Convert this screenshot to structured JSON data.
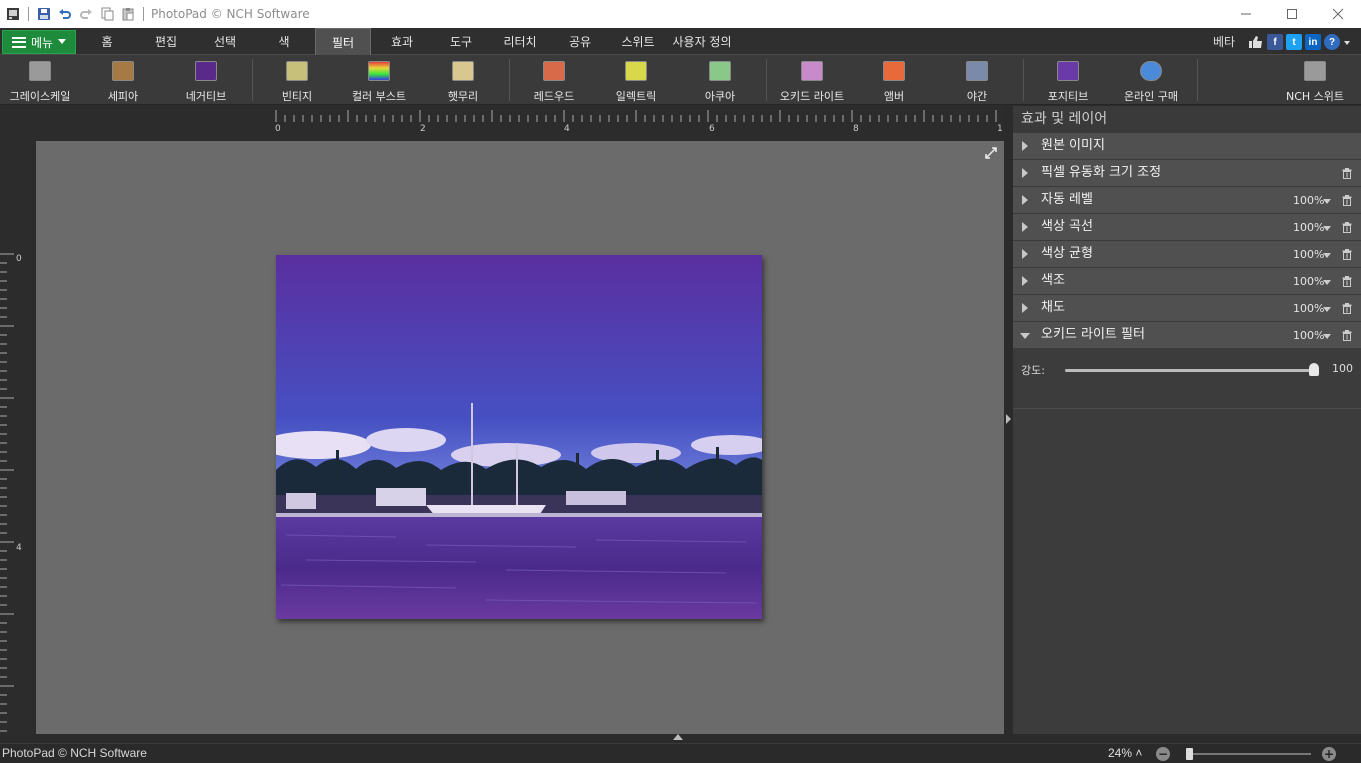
{
  "window": {
    "title": "PhotoPad © NCH Software",
    "controls": [
      "minimize",
      "maximize",
      "close"
    ]
  },
  "quick_access_icons": [
    "app-icon",
    "save-icon",
    "undo-icon",
    "redo-icon",
    "copy-icon",
    "paste-icon"
  ],
  "menu_button": {
    "label": "메뉴"
  },
  "tabs": [
    {
      "label": "홈"
    },
    {
      "label": "편집"
    },
    {
      "label": "선택"
    },
    {
      "label": "색"
    },
    {
      "label": "필터",
      "active": true
    },
    {
      "label": "효과"
    },
    {
      "label": "도구"
    },
    {
      "label": "리터치"
    },
    {
      "label": "공유"
    },
    {
      "label": "스위트"
    },
    {
      "label": "사용자 정의"
    }
  ],
  "beta_label": "베타",
  "social_icons": [
    "like-icon",
    "facebook-icon",
    "twitter-icon",
    "linkedin-icon",
    "help-icon"
  ],
  "ribbon": {
    "buttons": [
      {
        "label": "그레이스케일",
        "icon": "grayscale-icon",
        "color": "#9a9a9a"
      },
      {
        "label": "세피아",
        "icon": "sepia-icon",
        "color": "#a57a45"
      },
      {
        "label": "네거티브",
        "icon": "negative-icon",
        "color": "#5a2a8a"
      },
      {
        "label": "빈티지",
        "icon": "vintage-icon",
        "color": "#c7c07a"
      },
      {
        "label": "컬러 부스트",
        "icon": "color-boost-icon",
        "color": "#d83ad8"
      },
      {
        "label": "햇무리",
        "icon": "halo-icon",
        "color": "#d8c890"
      },
      {
        "label": "레드우드",
        "icon": "redwood-icon",
        "color": "#d86a4a"
      },
      {
        "label": "일렉트릭",
        "icon": "electric-icon",
        "color": "#d8d84a"
      },
      {
        "label": "아쿠아",
        "icon": "aqua-icon",
        "color": "#8ac88a"
      },
      {
        "label": "오키드 라이트",
        "icon": "orchid-light-icon",
        "color": "#c88ac8"
      },
      {
        "label": "앰버",
        "icon": "amber-icon",
        "color": "#e86a3a"
      },
      {
        "label": "야간",
        "icon": "night-icon",
        "color": "#7a8aa8"
      },
      {
        "label": "포지티브",
        "icon": "positive-icon",
        "color": "#6a3aa8"
      },
      {
        "label": "온라인 구매",
        "icon": "buy-online-icon",
        "color": "#4a8ad8"
      },
      {
        "label": "NCH 스위트",
        "icon": "nch-suite-icon",
        "color": "#9a9a9a"
      }
    ]
  },
  "ruler": {
    "top_labels": [
      "0",
      "2",
      "4",
      "6",
      "8",
      "1"
    ],
    "left_labels": [
      "0",
      "4"
    ]
  },
  "panel": {
    "title": "효과 및 레이어",
    "layers": [
      {
        "name": "원본 이미지",
        "opacity": "",
        "deletable": false,
        "expanded": false
      },
      {
        "name": "픽셀 유동화 크기 조정",
        "opacity": "",
        "deletable": true,
        "expanded": false
      },
      {
        "name": "자동 레벨",
        "opacity": "100%",
        "deletable": true,
        "expanded": false
      },
      {
        "name": "색상 곡선",
        "opacity": "100%",
        "deletable": true,
        "expanded": false
      },
      {
        "name": "색상 균형",
        "opacity": "100%",
        "deletable": true,
        "expanded": false
      },
      {
        "name": "색조",
        "opacity": "100%",
        "deletable": true,
        "expanded": false
      },
      {
        "name": "채도",
        "opacity": "100%",
        "deletable": true,
        "expanded": false
      },
      {
        "name": "오키드 라이트 필터",
        "opacity": "100%",
        "deletable": true,
        "expanded": true
      }
    ],
    "strength": {
      "label": "강도:",
      "value": "100",
      "level": 1.0
    }
  },
  "status": {
    "text": "PhotoPad © NCH Software",
    "zoom": "24%",
    "zoom_level": 0.02
  }
}
